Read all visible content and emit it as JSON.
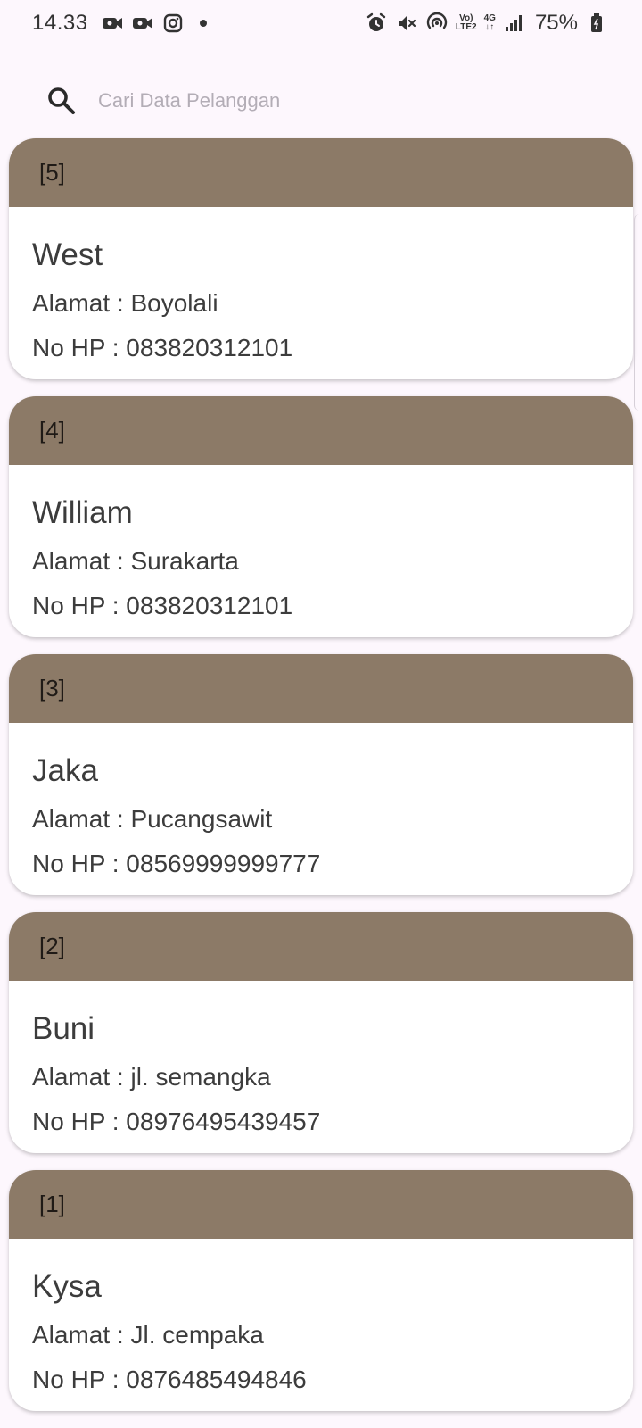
{
  "status_bar": {
    "time": "14.33",
    "net_top": "Vo)",
    "net_bottom": "LTE2",
    "data_top": "4G",
    "data_bottom": "↓↑",
    "battery": "75%",
    "icons": [
      "video-icon",
      "video-icon",
      "instagram-icon",
      "dot-icon",
      "alarm-icon",
      "mute-icon",
      "hotspot-icon",
      "signal-icon",
      "battery-icon"
    ]
  },
  "search": {
    "placeholder": "Cari Data Pelanggan",
    "value": ""
  },
  "customers": [
    {
      "id": "[5]",
      "name": "West",
      "address": "Alamat : Boyolali",
      "phone": "No HP : 083820312101"
    },
    {
      "id": "[4]",
      "name": "William",
      "address": "Alamat : Surakarta",
      "phone": "No HP : 083820312101"
    },
    {
      "id": "[3]",
      "name": "Jaka",
      "address": "Alamat : Pucangsawit",
      "phone": "No HP : 08569999999777"
    },
    {
      "id": "[2]",
      "name": "Buni",
      "address": "Alamat : jl. semangka",
      "phone": "No HP : 08976495439457"
    },
    {
      "id": "[1]",
      "name": "Kysa",
      "address": "Alamat : Jl. cempaka",
      "phone": "No HP : 0876485494846"
    }
  ],
  "colors": {
    "background": "#fdf7fd",
    "card_header": "#8c7a67",
    "card_body": "#ffffff"
  }
}
